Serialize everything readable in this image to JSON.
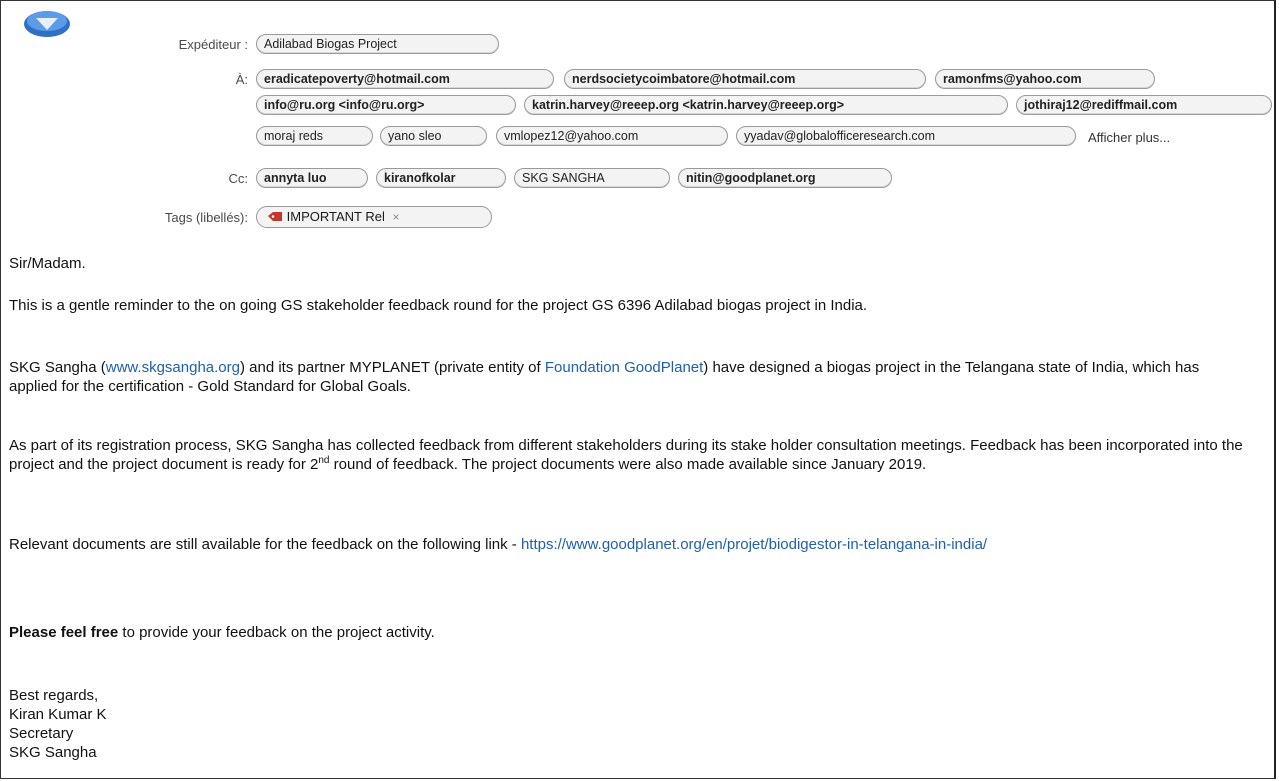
{
  "header": {
    "from_label": "Expéditeur :",
    "from_value": "Adilabad Biogas Project",
    "to_label": "À:",
    "to": [
      "eradicatepoverty@hotmail.com",
      "nerdsocietycoimbatore@hotmail.com",
      "ramonfms@yahoo.com",
      "info@ru.org <info@ru.org>",
      "katrin.harvey@reeep.org <katrin.harvey@reeep.org>",
      "jothiraj12@rediffmail.com",
      "moraj reds",
      "yano sleo",
      "vmlopez12@yahoo.com",
      "yyadav@globalofficeresearch.com"
    ],
    "show_more": "Afficher plus...",
    "cc_label": "Cc:",
    "cc": [
      "annyta luo",
      "kiranofkolar",
      "SKG SANGHA",
      "nitin@goodplanet.org"
    ],
    "tags_label": "Tags (libellés):",
    "tag_value": "IMPORTANT Rel",
    "tag_remove": "×"
  },
  "body": {
    "greeting": "Sir/Madam.",
    "p1": "This is a gentle reminder to the on going GS stakeholder feedback round for the project   GS 6396 Adilabad biogas project in India.",
    "p2_a": "SKG Sangha (",
    "p2_link1": "www.skgsangha.org",
    "p2_b": ") and its partner MYPLANET (private entity of ",
    "p2_link2": "Foundation GoodPlanet",
    "p2_c": ") have designed a biogas project in the Telangana state of India, which has applied for the certification - Gold Standard for Global Goals.",
    "p3_a": "As part of its registration process, SKG Sangha has collected feedback from different stakeholders during its stake holder consultation meetings. Feedback has been incorporated into the project and the project document is ready for 2",
    "p3_sup": "nd",
    "p3_b": " round of feedback. The project documents were also made available since January 2019.",
    "p4_a": "Relevant documents are still available for the feedback on the following link - ",
    "p4_link": "https://www.goodplanet.org/en/projet/biodigestor-in-telangana-in-india/",
    "p5_a": "Please feel free",
    "p5_b": " to provide your feedback on the project activity.",
    "sig1": "Best regards,",
    "sig2": "Kiran Kumar K",
    "sig3": "Secretary",
    "sig4": "SKG Sangha"
  },
  "colors": {
    "link": "#1f5fae",
    "avatar": "#3a7fd5",
    "tag_icon": "#c0392b"
  }
}
